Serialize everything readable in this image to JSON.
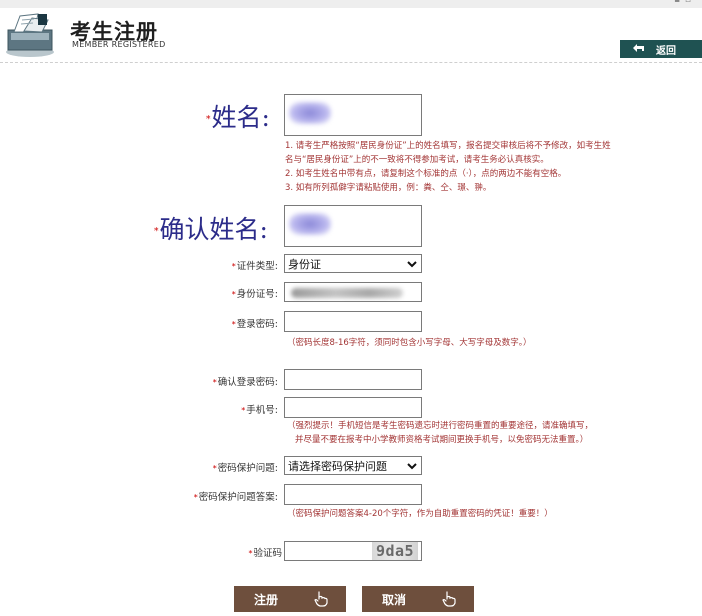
{
  "header": {
    "title_cn": "考生注册",
    "title_en": "MEMBER REGISTERED",
    "back_label": "返回",
    "top_right_marks": "▪ ▫"
  },
  "form": {
    "name": {
      "label": "姓名:",
      "star": "*",
      "value": ""
    },
    "name_notes": [
      "1. 请考生严格按照“居民身份证”上的姓名填写，报名提交审核后将不予修改，如考生姓",
      "名与“居民身份证”上的不一致将不得参加考试，请考生务必认真核实。",
      "2. 如考生姓名中带有点，请复制这个标准的点（·），点的两边不能有空格。",
      "3. 如有所列孤僻字请粘贴使用，例：粪、仝、璟、翀。"
    ],
    "confirm_name": {
      "label": "确认姓名:",
      "star": "*",
      "value": ""
    },
    "id_type": {
      "label": "证件类型:",
      "star": "*",
      "selected": "身份证"
    },
    "id_number": {
      "label": "身份证号:",
      "star": "*",
      "value": ""
    },
    "password": {
      "label": "登录密码:",
      "star": "*",
      "value": "",
      "hint": "（密码长度8-16字符，须同时包含小写字母、大写字母及数字。）"
    },
    "confirm_password": {
      "label": "确认登录密码:",
      "star": "*",
      "value": ""
    },
    "phone": {
      "label": "手机号:",
      "star": "*",
      "value": "",
      "hint_lines": [
        "（强烈提示！手机短信是考生密码遗忘时进行密码重置的重要途径，请准确填写，",
        "并尽量不要在报考中小学教师资格考试期间更换手机号，以免密码无法重置。）"
      ]
    },
    "security_question": {
      "label": "密码保护问题:",
      "star": "*",
      "selected": "请选择密码保护问题"
    },
    "security_answer": {
      "label": "密码保护问题答案:",
      "star": "*",
      "value": "",
      "hint": "（密码保护问题答案4-20个字符，作为自助重置密码的凭证！重要！）"
    },
    "captcha": {
      "label": "验证码",
      "star": "*",
      "value": "",
      "image_text": "9da5"
    }
  },
  "actions": {
    "register_label": "注册",
    "cancel_label": "取消"
  },
  "colors": {
    "accent_teal": "#1f5252",
    "button_brown": "#6e4f3d",
    "note_red": "#a33636",
    "label_blue": "#2c2c8a",
    "required_star": "#cc0000"
  },
  "icons": [
    "document-stack-logo-icon",
    "back-arrow-icon",
    "chevron-down-icon",
    "hand-pointer-icon"
  ]
}
